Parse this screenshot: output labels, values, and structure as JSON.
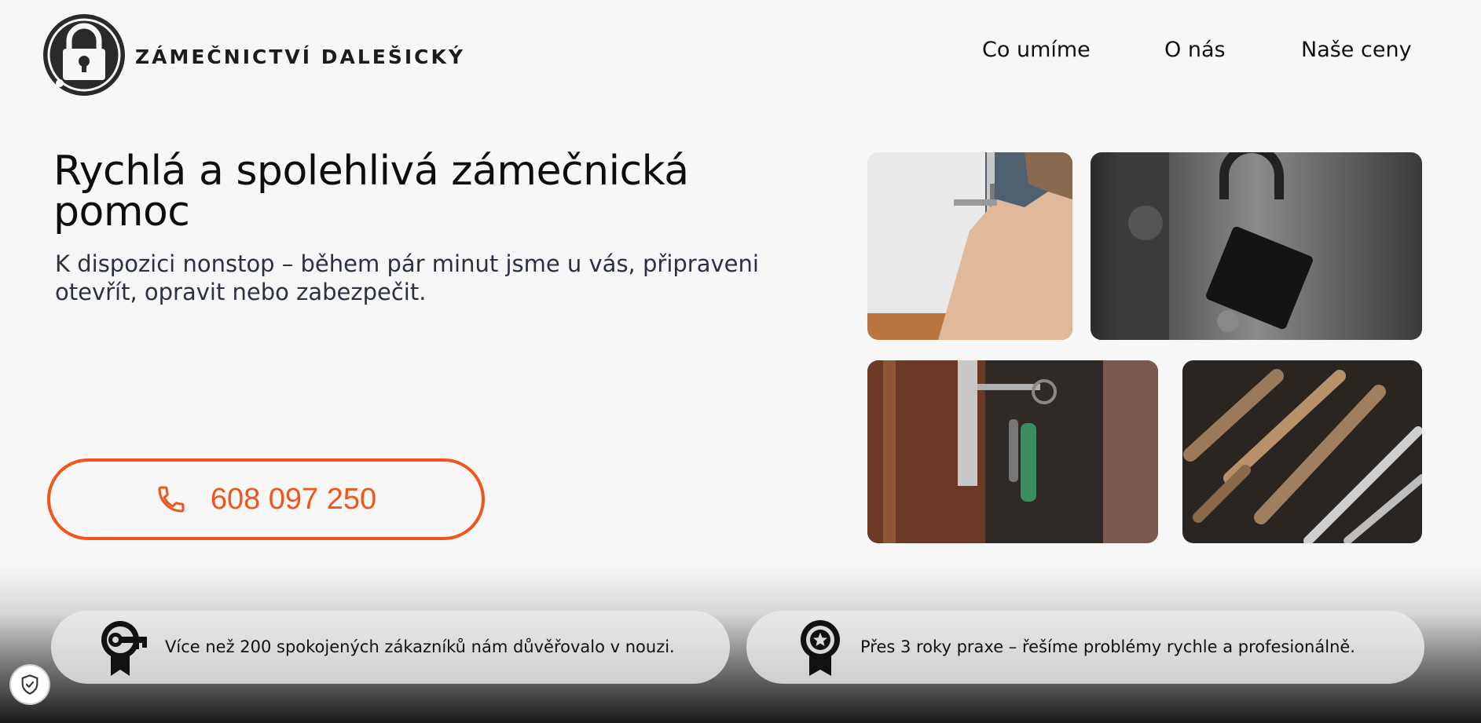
{
  "header": {
    "brand": "ZÁMEČNICTVÍ DALEŠICKÝ",
    "logo_icon": "padlock-gear-logo-icon",
    "nav": [
      {
        "label": "Co umíme"
      },
      {
        "label": "O nás"
      },
      {
        "label": "Naše ceny"
      }
    ]
  },
  "hero": {
    "title": "Rychlá a spolehlivá zámečnická pomoc",
    "subtitle": "K dispozici nonstop – během pár minut jsme u vás, připraveni otevřít, opravit nebo zabezpečit.",
    "phone_icon": "phone-icon",
    "phone": "608 097 250"
  },
  "gallery": [
    {
      "name": "door-lock-repair-photo"
    },
    {
      "name": "open-padlock-photo"
    },
    {
      "name": "key-in-door-photo"
    },
    {
      "name": "tools-wrenches-photo"
    }
  ],
  "features": [
    {
      "icon": "key-badge-icon",
      "text": "Více než 200 spokojených zákazníků nám důvěřovalo v nouzi."
    },
    {
      "icon": "star-badge-icon",
      "text": "Přes 3 roky praxe – řešíme problémy rychle a profesionálně."
    }
  ],
  "cookie_icon": "shield-check-icon",
  "colors": {
    "accent": "#f2541b",
    "background": "#f7f7f7",
    "text": "#111111"
  }
}
